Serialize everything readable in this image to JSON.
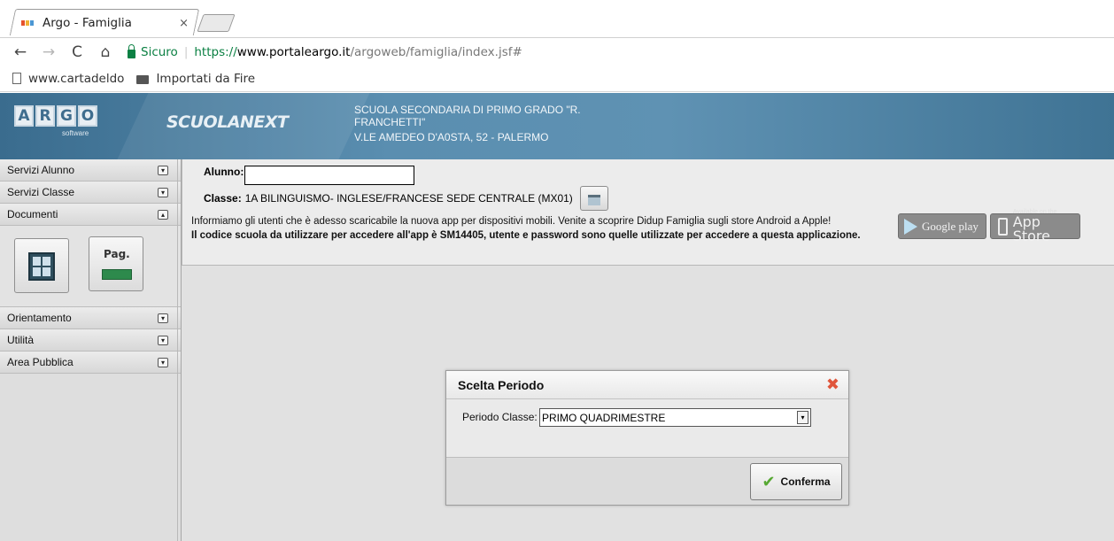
{
  "browser": {
    "tab_title": "Argo - Famiglia",
    "tab_close": "×",
    "secure_label": "Sicuro",
    "url_scheme": "https://",
    "url_host": "www.portaleargo.it",
    "url_path": "/argoweb/famiglia/index.jsf#",
    "bookmarks": [
      {
        "label": "www.cartadeldo",
        "icon": "page-icon"
      },
      {
        "label": "Importati da Fire",
        "icon": "folder-icon"
      }
    ]
  },
  "header": {
    "logo_letters": [
      "A",
      "R",
      "G",
      "O"
    ],
    "logo_sub": "software",
    "product": "SCUOLANEXT",
    "school_name": "SCUOLA SECONDARIA DI PRIMO GRADO \"R. FRANCHETTI\"",
    "school_address": "V.LE AMEDEO D'A0STA, 52 - PALERMO"
  },
  "sidebar": {
    "items_top": [
      {
        "label": "Servizi Alunno",
        "toggle": "▾"
      },
      {
        "label": "Servizi Classe",
        "toggle": "▾"
      },
      {
        "label": "Documenti",
        "toggle": "▴"
      }
    ],
    "doc_tile_pag": "Pag.",
    "items_bottom": [
      {
        "label": "Orientamento",
        "toggle": "▾"
      },
      {
        "label": "Utilità",
        "toggle": "▾"
      },
      {
        "label": "Area Pubblica",
        "toggle": "▾"
      }
    ]
  },
  "main": {
    "alunno_label": "Alunno:",
    "alunno_value": "",
    "classe_label": "Classe:",
    "classe_value": "1A BILINGUISMO- INGLESE/FRANCESE SEDE CENTRALE (MX01)",
    "notice_line1": "Informiamo gli utenti che è adesso scaricabile la nuova app per dispositivi mobili. Venite a scoprire Didup Famiglia sugli store Android a Apple!",
    "notice_line2": "Il codice scuola da utilizzare per accedere all'app è SM14405, utente e password sono quelle utilizzate per accedere a questa applicazione.",
    "google_play": "Google play",
    "app_store_small": "Available on the",
    "app_store_big": "App Store"
  },
  "dialog": {
    "title": "Scelta Periodo",
    "close": "✖",
    "periodo_label": "Periodo Classe:",
    "periodo_value": "PRIMO QUADRIMESTRE",
    "select_arrow": "▾",
    "confirm_label": "Conferma",
    "confirm_icon": "✔"
  },
  "colors": {
    "header_blue": "#4f83a6",
    "secure_green": "#0b8043",
    "close_red": "#e0553b",
    "check_green": "#56a832"
  }
}
